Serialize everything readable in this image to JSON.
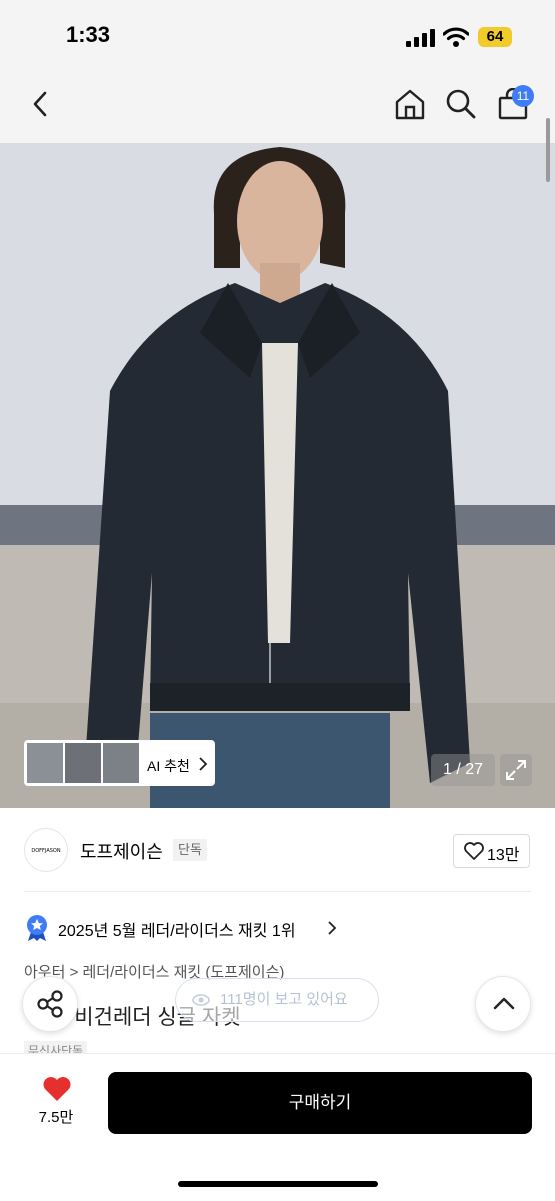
{
  "status_bar": {
    "time": "1:33",
    "battery": "64"
  },
  "nav": {
    "cart_count": "11"
  },
  "hero": {
    "ai_label": "AI 추천",
    "image_counter": "1 / 27"
  },
  "brand": {
    "logo_text": "DOFFJASON",
    "name": "도프제이슨",
    "tag": "단독",
    "like_count": "13만"
  },
  "ranking": {
    "text": "2025년 5월 레더/라이더스 재킷 1위"
  },
  "breadcrumb": "아우터 > 레더/라이더스 재킷 (도프제이슨)",
  "product": {
    "title": "ㅡ 킷 비건레더 싱글 자켓",
    "viewers": "111명이 보고 있어요",
    "tag": "무신사단독"
  },
  "bottom": {
    "heart_count": "7.5만",
    "buy_label": "구매하기"
  },
  "colors": {
    "accent_blue": "#3f7cf5",
    "heart_red": "#e5302e",
    "battery": "#f2cb2a"
  },
  "icons": [
    "back-icon",
    "home-icon",
    "search-icon",
    "cart-icon",
    "chevron-right-icon",
    "expand-icon",
    "heart-outline-icon",
    "award-badge-icon",
    "share-icon",
    "chevron-up-icon",
    "heart-icon"
  ]
}
